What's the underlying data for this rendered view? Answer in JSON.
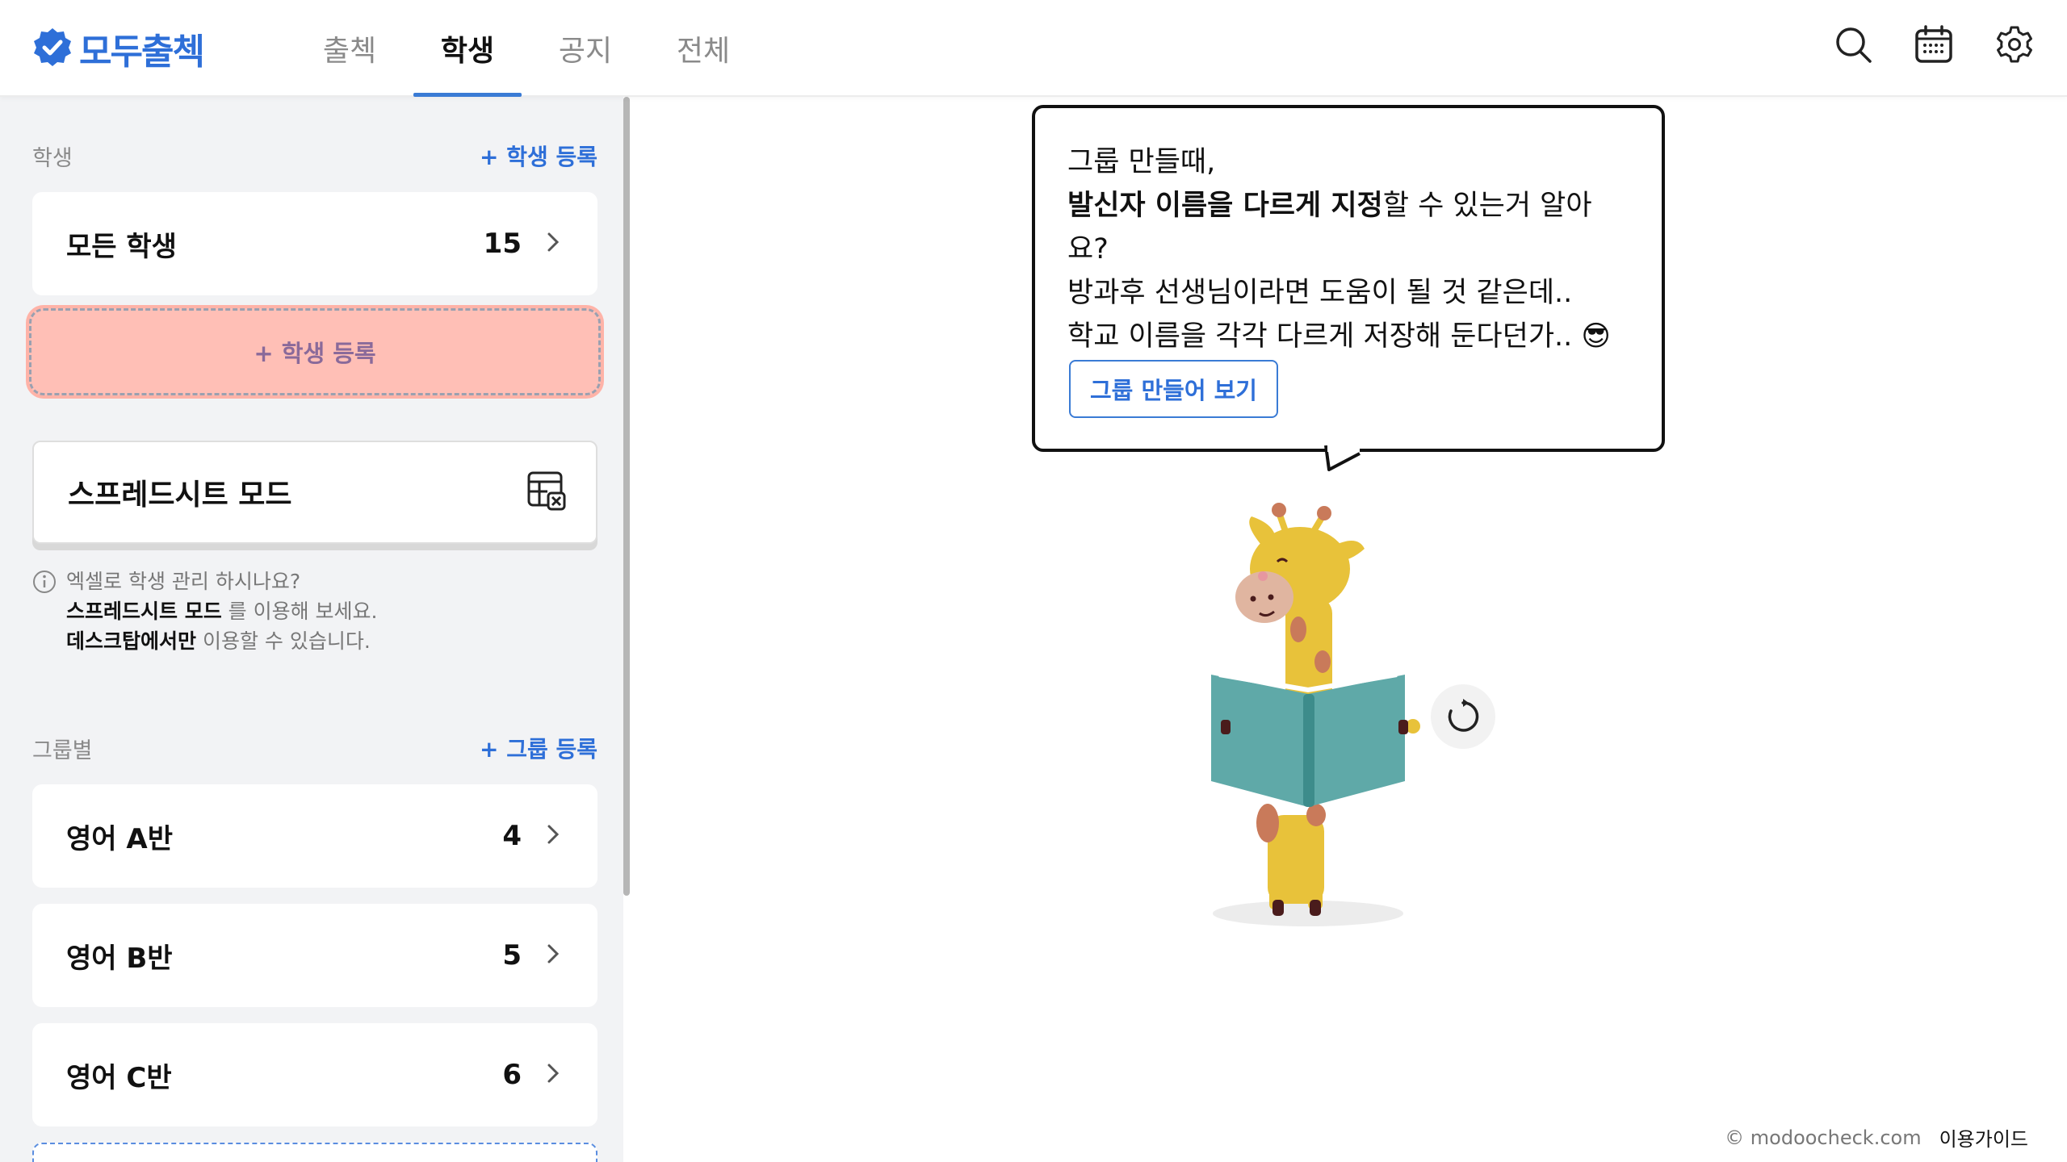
{
  "app": {
    "logo_text": "모두출첵"
  },
  "nav": {
    "tabs": [
      {
        "label": "출첵"
      },
      {
        "label": "학생"
      },
      {
        "label": "공지"
      },
      {
        "label": "전체"
      }
    ],
    "active_index": 1
  },
  "header_icons": [
    "search-icon",
    "calendar-icon",
    "gear-icon"
  ],
  "sidebar": {
    "students_section": {
      "label": "학생",
      "action": "+ 학생 등록"
    },
    "all_students": {
      "label": "모든 학생",
      "count": "15"
    },
    "add_student_label": "+ 학생 등록",
    "spreadsheet": {
      "label": "스프레드시트 모드"
    },
    "info": {
      "line1": "엑셀로 학생 관리 하시나요?",
      "line2_bold": "스프레드시트 모드",
      "line2_rest": " 를 이용해 보세요.",
      "line3_bold": "데스크탑에서만",
      "line3_rest": " 이용할 수 있습니다."
    },
    "groups_section": {
      "label": "그룹별",
      "action": "+ 그룹 등록"
    },
    "groups": [
      {
        "label": "영어 A반",
        "count": "4"
      },
      {
        "label": "영어 B반",
        "count": "5"
      },
      {
        "label": "영어 C반",
        "count": "6"
      }
    ]
  },
  "bubble": {
    "line1": "그룹 만들때,",
    "line2_bold": "발신자 이름을 다르게 지정",
    "line2_rest": "할 수 있는거 알아요?",
    "line3": "방과후 선생님이라면 도움이 될 것 같은데..",
    "line4": "학교 이름을 각각 다르게 저장해 둔다던가.. 😎",
    "button": "그룹 만들어 보기"
  },
  "footer": {
    "copyright": "© modoocheck.com",
    "guide": "이용가이드"
  },
  "colors": {
    "brand": "#2e6fd8",
    "highlight": "#ffbfb6",
    "sidebar_bg": "#f2f3f5"
  }
}
